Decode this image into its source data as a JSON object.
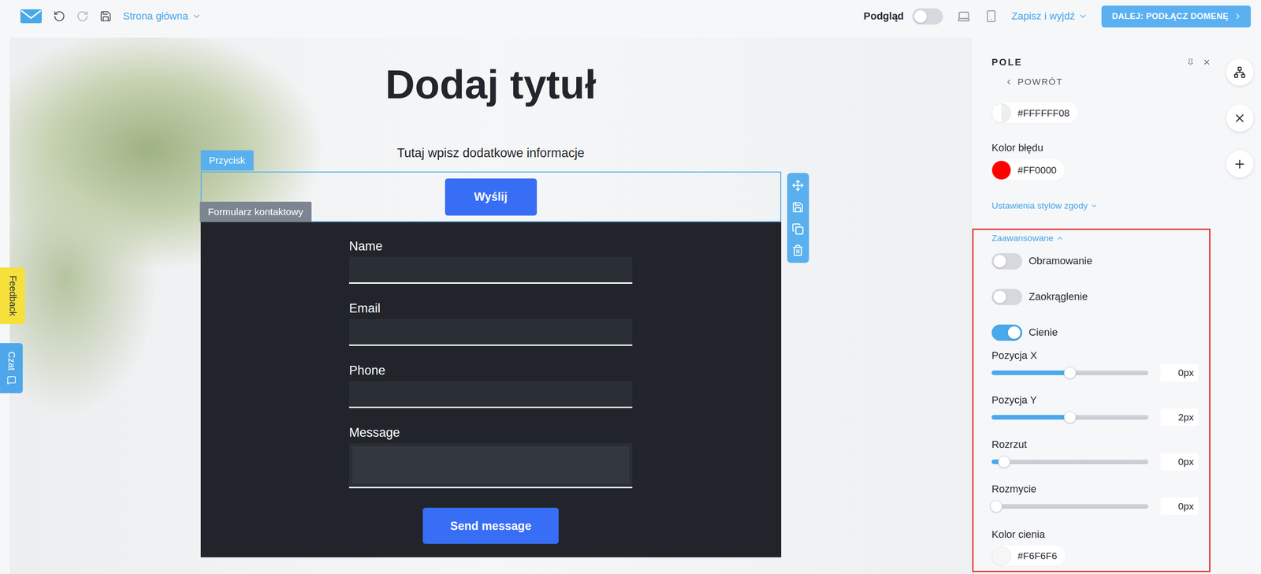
{
  "toolbar": {
    "page_selector": "Strona główna",
    "preview_label": "Podgląd",
    "preview_on": false,
    "save_exit": "Zapisz i wyjdź",
    "next_button": "DALEJ: PODŁĄCZ DOMENĘ"
  },
  "side_tabs": [
    {
      "label": "Feedback",
      "color": "#f5e03c",
      "text_color": "#333333"
    },
    {
      "label": "Czat",
      "color": "#4ea7ea",
      "text_color": "#ffffff"
    }
  ],
  "canvas": {
    "title": "Dodaj tytuł",
    "subtitle": "Tutaj wpisz dodatkowe informacje",
    "button_section": {
      "label": "Przycisk",
      "selected": true,
      "button": "Wyślij"
    },
    "form": {
      "label": "Formularz kontaktowy",
      "fields": [
        {
          "label": "Name",
          "kind": "input"
        },
        {
          "label": "Email",
          "kind": "input"
        },
        {
          "label": "Phone",
          "kind": "input"
        },
        {
          "label": "Message",
          "kind": "textarea"
        }
      ],
      "submit": "Send message"
    }
  },
  "panel": {
    "title": "POLE",
    "back": "POWRÓT",
    "background_color": {
      "value": "#FFFFFF08"
    },
    "error_color": {
      "label": "Kolor błędu",
      "value": "#FF0000"
    },
    "consent_link": {
      "label": "Ustawienia stylów zgody",
      "expanded": false
    },
    "advanced": {
      "label": "Zaawansowane",
      "expanded": true,
      "highlighted": true,
      "toggles": [
        {
          "label": "Obramowanie",
          "on": false
        },
        {
          "label": "Zaokrąglenie",
          "on": false
        },
        {
          "label": "Cienie",
          "on": true
        }
      ],
      "sliders": [
        {
          "label": "Pozycja X",
          "level": 0.5,
          "reading": "0px"
        },
        {
          "label": "Pozycja Y",
          "level": 0.5,
          "reading": "2px"
        },
        {
          "label": "Rozrzut",
          "level": 0.08,
          "reading": "0px"
        },
        {
          "label": "Rozmycie",
          "level": 0.03,
          "reading": "0px"
        }
      ],
      "shadow_color": {
        "label": "Kolor cienia",
        "value": "#F6F6F6"
      }
    }
  }
}
